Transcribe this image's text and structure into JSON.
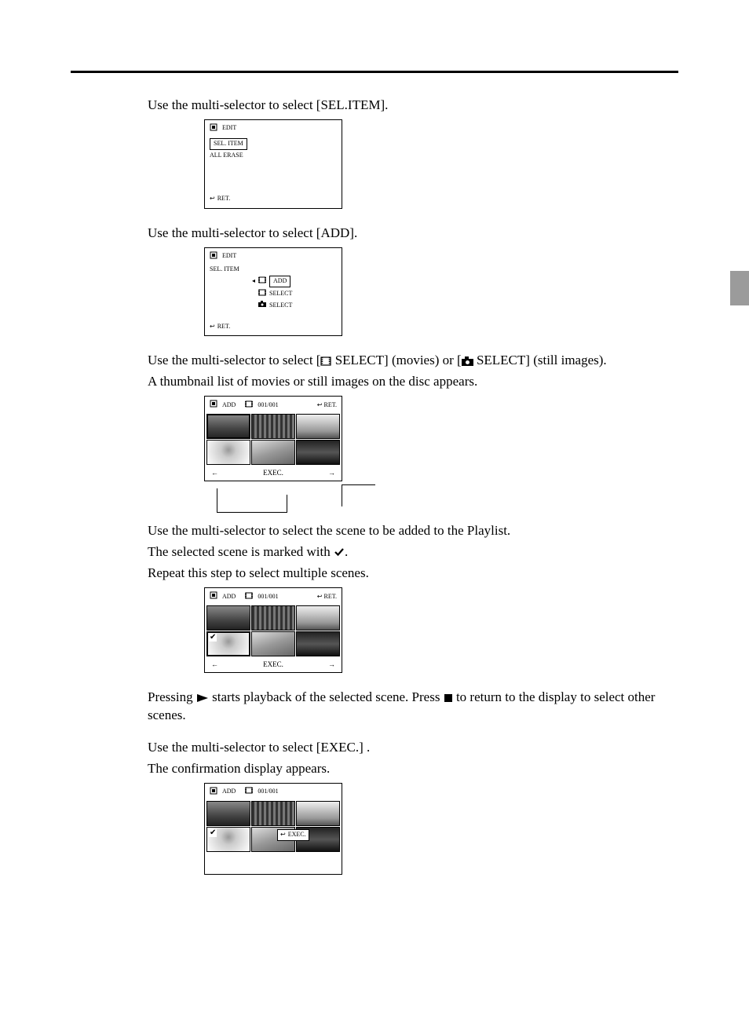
{
  "steps": {
    "s2": "Use the multi-selector to select [SEL.ITEM].",
    "s3": "Use the multi-selector to select [ADD].",
    "s4a": "Use the multi-selector to select  [",
    "s4b": " SELECT] (movies) or [",
    "s4c": " SELECT] (still images).",
    "s4d": "A thumbnail list of movies or still images on the disc appears.",
    "s5a": "Use the multi-selector to select the scene to be added to the Playlist.",
    "s5b": "The selected scene is marked with ",
    "s5c": ".",
    "s5d": "Repeat this step to select multiple scenes.",
    "s5e": "Pressing ",
    "s5f": " starts playback of the selected scene. Press ",
    "s5g": " to return to the display to select other scenes.",
    "s6a": "Use the multi-selector to select  [EXEC.] .",
    "s6b": "The confirmation display appears."
  },
  "menu1": {
    "hdr": "EDIT",
    "sel": "SEL. ITEM",
    "all": "ALL ERASE",
    "ret": "RET."
  },
  "menu2": {
    "hdr": "EDIT",
    "sel": "SEL. ITEM",
    "add": "ADD",
    "movie": "SELECT",
    "still": "SELECT",
    "ret": "RET."
  },
  "thumbs": {
    "hdr_add": "ADD",
    "count": "001/001",
    "ret": "RET.",
    "exec": "EXEC."
  }
}
